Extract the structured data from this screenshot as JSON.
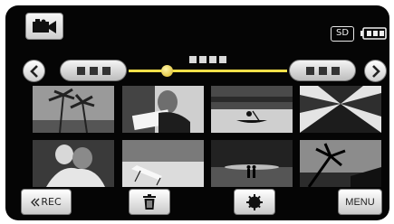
{
  "status": {
    "media_label": "SD",
    "mode_icon": "video-camera-icon",
    "battery_icon": "battery-icon"
  },
  "timeline": {
    "left_arrow_icon": "chevron-left-icon",
    "right_arrow_icon": "chevron-right-icon"
  },
  "thumbnails": [
    {
      "icon": "palm-trees-thumbnail"
    },
    {
      "icon": "person-reading-thumbnail"
    },
    {
      "icon": "canoe-lake-thumbnail"
    },
    {
      "icon": "palm-leaves-thumbnail"
    },
    {
      "icon": "couple-hug-thumbnail"
    },
    {
      "icon": "beach-chair-thumbnail"
    },
    {
      "icon": "couple-silhouette-thumbnail"
    },
    {
      "icon": "sunset-palm-thumbnail"
    }
  ],
  "bottom_bar": {
    "rec_label": "REC",
    "menu_label": "MENU",
    "trash_icon": "trash-icon",
    "settings_icon": "settings-gear-icon"
  },
  "colors": {
    "accent": "#f6e04a",
    "background": "#050505"
  }
}
